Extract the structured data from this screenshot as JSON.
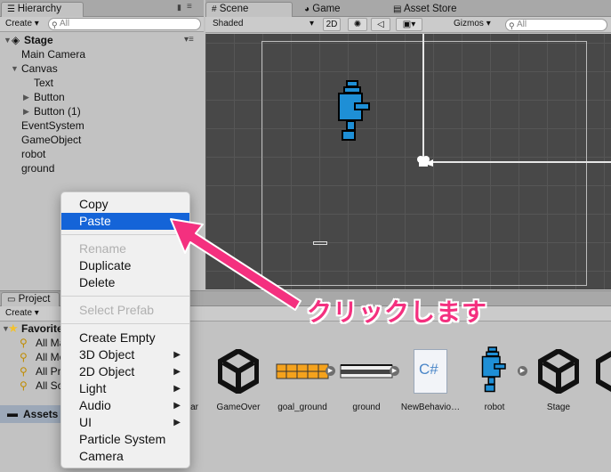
{
  "hierarchy": {
    "tab_label": "Hierarchy",
    "create_label": "Create",
    "search_placeholder": "All",
    "scene_name": "Stage",
    "items": [
      {
        "label": "Main Camera"
      },
      {
        "label": "Canvas"
      },
      {
        "label": "Text"
      },
      {
        "label": "Button"
      },
      {
        "label": "Button (1)"
      },
      {
        "label": "EventSystem"
      },
      {
        "label": "GameObject"
      },
      {
        "label": "robot"
      },
      {
        "label": "ground"
      }
    ]
  },
  "scene": {
    "tabs": [
      {
        "label": "Scene"
      },
      {
        "label": "Game"
      },
      {
        "label": "Asset Store"
      }
    ],
    "shading_mode": "Shaded",
    "mode_2d": "2D",
    "gizmos_label": "Gizmos",
    "search_placeholder": "All"
  },
  "project": {
    "tab_label": "Project",
    "create_label": "Create",
    "favorites_label": "Favorites",
    "favorite_items": [
      {
        "label": "All Ma"
      },
      {
        "label": "All Mo"
      },
      {
        "label": "All Pr"
      },
      {
        "label": "All Sc"
      }
    ],
    "assets_label": "Assets",
    "assets": [
      {
        "label": "ar",
        "icon": "unity-icon"
      },
      {
        "label": "GameOver",
        "icon": "unity-icon"
      },
      {
        "label": "goal_ground",
        "icon": "sprite-icon"
      },
      {
        "label": "ground",
        "icon": "sprite-icon"
      },
      {
        "label": "NewBehavio…",
        "icon": "csharp-icon"
      },
      {
        "label": "robot",
        "icon": "robot-sprite-icon"
      },
      {
        "label": "Stage",
        "icon": "unity-icon"
      }
    ],
    "csharp_glyph": "C#"
  },
  "context_menu": {
    "items": [
      {
        "label": "Copy",
        "state": "normal"
      },
      {
        "label": "Paste",
        "state": "selected"
      },
      {
        "label": "Rename",
        "state": "disabled"
      },
      {
        "label": "Duplicate",
        "state": "normal"
      },
      {
        "label": "Delete",
        "state": "normal"
      },
      {
        "label": "Select Prefab",
        "state": "disabled"
      },
      {
        "label": "Create Empty",
        "state": "normal"
      },
      {
        "label": "3D Object",
        "state": "submenu"
      },
      {
        "label": "2D Object",
        "state": "submenu"
      },
      {
        "label": "Light",
        "state": "submenu"
      },
      {
        "label": "Audio",
        "state": "submenu"
      },
      {
        "label": "UI",
        "state": "submenu"
      },
      {
        "label": "Particle System",
        "state": "normal"
      },
      {
        "label": "Camera",
        "state": "normal"
      }
    ]
  },
  "annotation": {
    "text": "クリックします",
    "color": "#f4307f"
  },
  "colors": {
    "selection_blue": "#1464d8",
    "robot_blue": "#1e8fd6",
    "scene_bg": "#484848"
  }
}
